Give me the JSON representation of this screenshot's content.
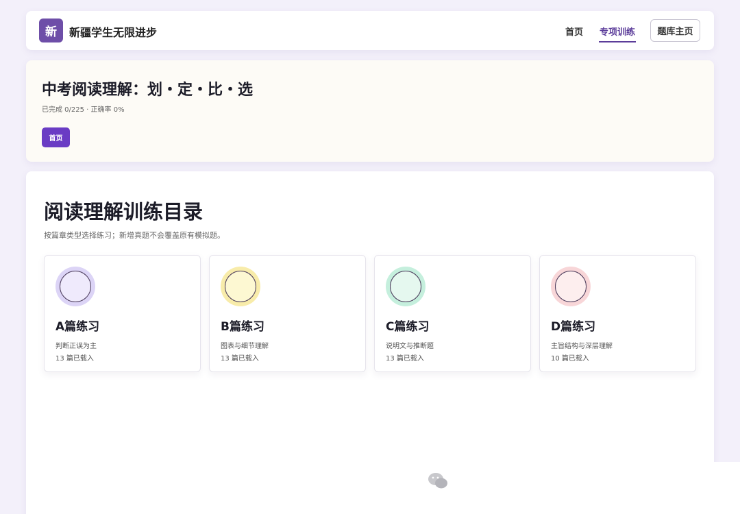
{
  "header": {
    "logo_char": "新",
    "site_name": "新疆学生无限进步",
    "nav": {
      "home": "首页",
      "training": "专项训练"
    },
    "bank_button": "题库主页"
  },
  "hero": {
    "title": "中考阅读理解：划・定・比・选",
    "status": "已完成 0/225 · 正确率 0%",
    "button": "首页"
  },
  "main": {
    "title": "阅读理解训练目录",
    "subtitle": "按篇章类型选择练习；新增真题不会覆盖原有模拟题。",
    "cards": [
      {
        "title": "A篇练习",
        "desc": "判断正误为主",
        "count": "13 篇已载入",
        "ring_color": "#dcd4f6",
        "fill_color": "#efeafc"
      },
      {
        "title": "B篇练习",
        "desc": "图表与细节理解",
        "count": "13 篇已载入",
        "ring_color": "#f8ecaa",
        "fill_color": "#fdf8d2"
      },
      {
        "title": "C篇练习",
        "desc": "说明文与推断题",
        "count": "13 篇已载入",
        "ring_color": "#c5efdd",
        "fill_color": "#e5f8ef"
      },
      {
        "title": "D篇练习",
        "desc": "主旨结构与深层理解",
        "count": "10 篇已载入",
        "ring_color": "#f8d6d8",
        "fill_color": "#fdeeee"
      }
    ]
  },
  "colors": {
    "accent": "#6a3cc4",
    "logo_bg": "#6e4ea8",
    "page_bg": "#f3f0fa"
  },
  "icons": {
    "watermark": "wechat-icon"
  }
}
